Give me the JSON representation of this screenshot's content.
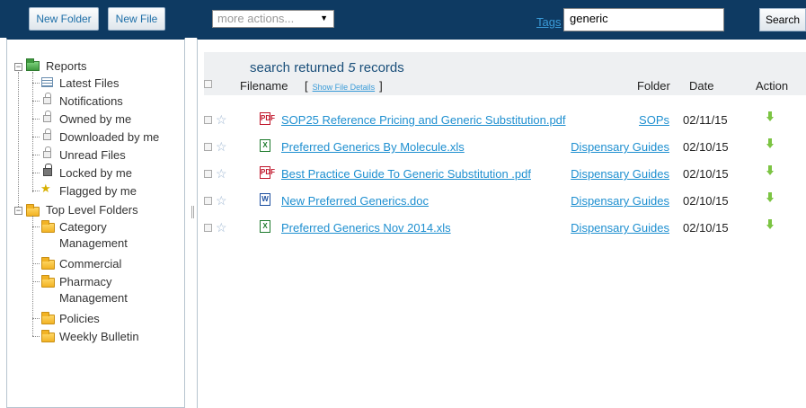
{
  "toolbar": {
    "new_folder_label": "New Folder",
    "new_file_label": "New File",
    "actions_select_value": "more actions...",
    "tags_label": "Tags",
    "search_value": "generic",
    "search_button_label": "Search"
  },
  "sidebar": {
    "reports_label": "Reports",
    "report_items": [
      {
        "label": "Latest Files",
        "icon": "list-icon"
      },
      {
        "label": "Notifications",
        "icon": "lock-icon"
      },
      {
        "label": "Owned by me",
        "icon": "lock-icon"
      },
      {
        "label": "Downloaded by me",
        "icon": "lock-icon"
      },
      {
        "label": "Unread Files",
        "icon": "lock-icon"
      },
      {
        "label": "Locked by me",
        "icon": "padlock-icon"
      },
      {
        "label": "Flagged by me",
        "icon": "star-icon"
      }
    ],
    "folders_label": "Top Level Folders",
    "folder_items": [
      {
        "label": "Category",
        "label2": "Management"
      },
      {
        "label": "Commercial"
      },
      {
        "label": "Pharmacy",
        "label2": "Management"
      },
      {
        "label": "Policies"
      },
      {
        "label": "Weekly Bulletin"
      }
    ]
  },
  "results": {
    "prefix": "search returned",
    "count": "5",
    "suffix": "records",
    "columns": {
      "filename": "Filename",
      "bracket_open": "[",
      "show_details": "Show File Details",
      "bracket_close": "]",
      "folder": "Folder",
      "date": "Date",
      "action": "Action"
    },
    "files": [
      {
        "type": "pdf",
        "type_label": "PDF",
        "name": "SOP25 Reference Pricing and Generic Substitution.pdf",
        "folder": "SOPs",
        "date": "02/11/15"
      },
      {
        "type": "xls",
        "type_label": "X",
        "name": "Preferred Generics By Molecule.xls",
        "folder": "Dispensary Guides",
        "date": "02/10/15"
      },
      {
        "type": "pdf",
        "type_label": "PDF",
        "name": "Best Practice Guide To Generic Substitution .pdf",
        "folder": "Dispensary Guides",
        "date": "02/10/15"
      },
      {
        "type": "doc",
        "type_label": "W",
        "name": "New Preferred Generics.doc",
        "folder": "Dispensary Guides",
        "date": "02/10/15"
      },
      {
        "type": "xls",
        "type_label": "X",
        "name": "Preferred Generics Nov 2014.xls",
        "folder": "Dispensary Guides",
        "date": "02/10/15"
      }
    ]
  }
}
